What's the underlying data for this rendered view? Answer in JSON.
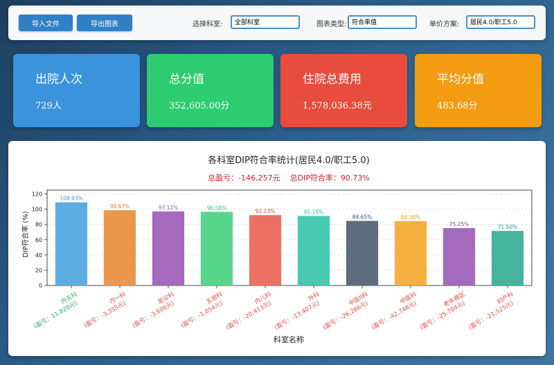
{
  "toolbar": {
    "import_label": "导入文件",
    "export_label": "导出图表",
    "dept_label": "选择科室:",
    "dept_value": "全部科室",
    "type_label": "图表类型:",
    "type_value": "符合率值",
    "price_label": "单价方案:",
    "price_value": "居民4.0/职工5.0"
  },
  "cards": [
    {
      "title": "出院人次",
      "value": "729人",
      "color": "#3a93dc"
    },
    {
      "title": "总分值",
      "value": "352,605.00分",
      "color": "#2ecc71"
    },
    {
      "title": "住院总费用",
      "value": "1,578,036.38元",
      "color": "#e74c3c"
    },
    {
      "title": "平均分值",
      "value": "483.68分",
      "color": "#f39c12"
    }
  ],
  "chart_data": {
    "type": "bar",
    "title": "各科室DIP符合率统计(居民4.0/职工5.0)",
    "subtitle": "总盈亏：-146,257元    总DIP符合率：90.73%",
    "xlabel": "科室名称",
    "ylabel": "DIP符合率 (%)",
    "ylim": [
      0,
      125
    ],
    "yticks": [
      0,
      20,
      40,
      60,
      80,
      100,
      120
    ],
    "grid": "horizontal dashed",
    "categories": [
      "内五科",
      "内一科",
      "急诊科",
      "五官科",
      "内儿科",
      "外科",
      "中医II科",
      "中医科",
      "老年病区",
      "妇产科"
    ],
    "values": [
      108.93,
      98.67,
      97.12,
      96.58,
      92.23,
      91.15,
      84.65,
      84.38,
      75.25,
      71.5
    ],
    "value_labels": [
      "108.93%",
      "98.67%",
      "97.12%",
      "96.58%",
      "92.23%",
      "91.15%",
      "84.65%",
      "84.38%",
      "75.25%",
      "71.50%"
    ],
    "profit_labels": [
      "(盈亏：11,820元)",
      "(盈亏：-3,335元)",
      "(盈亏：-3,606元)",
      "(盈亏：-1,054元)",
      "(盈亏：-20,413元)",
      "(盈亏：-13,407元)",
      "(盈亏：-26,286元)",
      "(盈亏：-42,748元)",
      "(盈亏：-25,704元)",
      "(盈亏：-21,525元)"
    ],
    "bar_colors": [
      "#5dade2",
      "#eb984e",
      "#a569bd",
      "#58d68d",
      "#ec7063",
      "#48c9b0",
      "#5d6d7e",
      "#f5b041",
      "#a569bd",
      "#45b39d"
    ],
    "label_colors": [
      "#3498db",
      "#e67e22",
      "#9b59b6",
      "#2ecc71",
      "#e74c3c",
      "#1abc9c",
      "#34495e",
      "#f39c12",
      "#8e44ad",
      "#16a085"
    ],
    "x_label_colors": [
      "#27ae60",
      "#e74c3c",
      "#e74c3c",
      "#e74c3c",
      "#e74c3c",
      "#e74c3c",
      "#e74c3c",
      "#e74c3c",
      "#e74c3c",
      "#e74c3c"
    ]
  }
}
